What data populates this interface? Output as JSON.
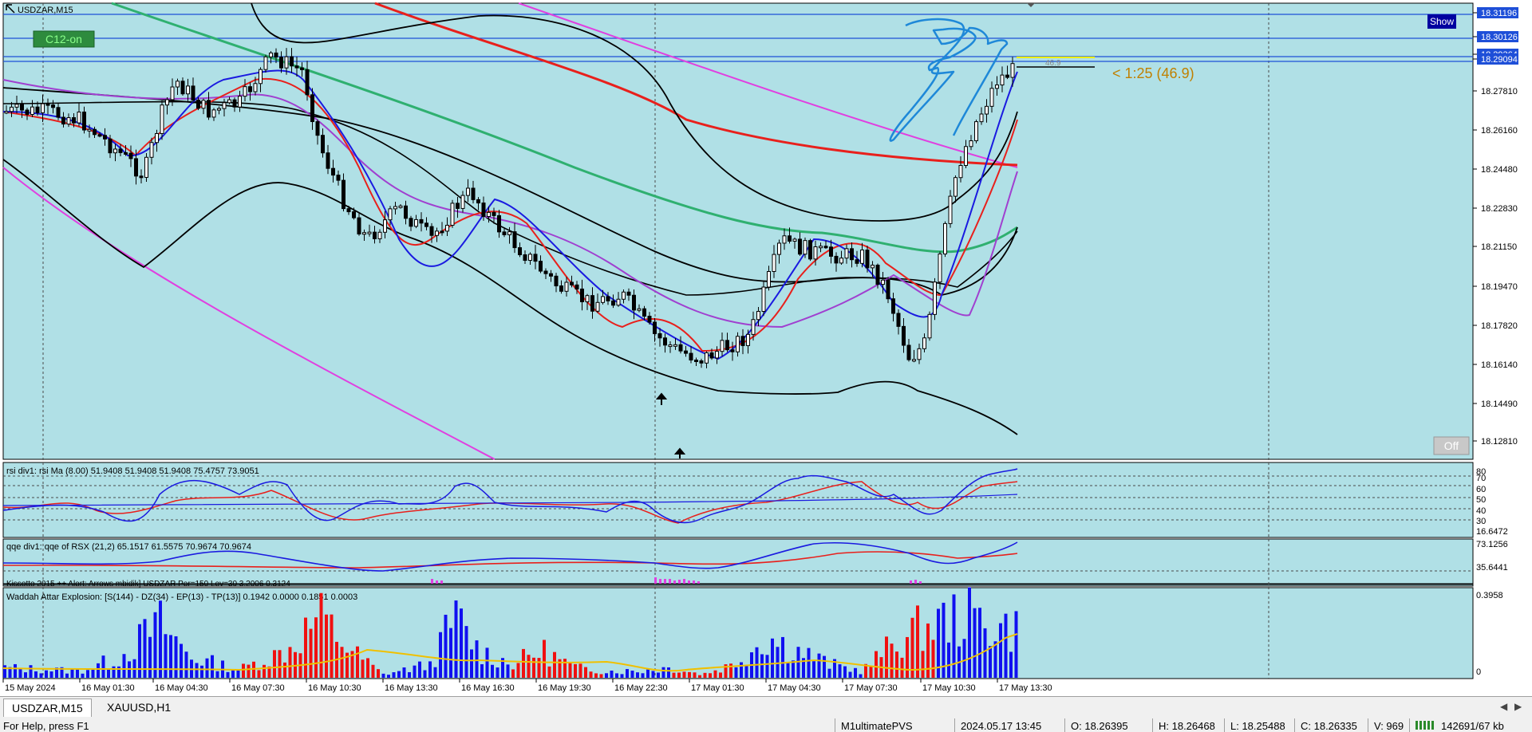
{
  "window": {
    "symbol_label": "USDZAR,M15"
  },
  "buttons": {
    "show": "Show",
    "off": "Off",
    "c12": "C12-on"
  },
  "annotation": {
    "rr_text": "< 1:25 (46.9)",
    "small_value": "46.9"
  },
  "price_axis": {
    "labels": [
      "18.31196",
      "18.30126",
      "18.29364",
      "18.29094",
      "18.27810",
      "18.26160",
      "18.24480",
      "18.22830",
      "18.21150",
      "18.19470",
      "18.17820",
      "18.16140",
      "18.14490",
      "18.12810"
    ],
    "highlighted": [
      "18.31196",
      "18.30126",
      "18.29364",
      "18.29094"
    ]
  },
  "time_axis": {
    "labels": [
      "15 May 2024",
      "16 May 01:30",
      "16 May 04:30",
      "16 May 07:30",
      "16 May 10:30",
      "16 May 13:30",
      "16 May 16:30",
      "16 May 19:30",
      "16 May 22:30",
      "17 May 01:30",
      "17 May 04:30",
      "17 May 07:30",
      "17 May 10:30",
      "17 May 13:30"
    ]
  },
  "indicators": {
    "rsi": {
      "label": "rsi div1: rsi Ma (8.00) 51.9408 51.9408 51.9408 75.4757 73.9051",
      "levels": [
        "80",
        "70",
        "60",
        "50",
        "40",
        "30",
        "16.6472"
      ]
    },
    "qqe": {
      "label": "qqe div1: qqe of RSX (21,2) 65.1517 61.5575 70.9674 70.9674",
      "levels": [
        "73.1256",
        "35.6441"
      ]
    },
    "kiss": {
      "label": "Kissotto 2015 ++ Alert: Arrows mbidik] USDZAR Per=150 Lev=30 3.2006 0.3124"
    },
    "wae": {
      "label": "Waddah Attar Explosion: [S(144) - DZ(34) - EP(13) - TP(13)] 0.1942 0.0000 0.1851 0.0003",
      "levels": [
        "0.3958",
        "0"
      ]
    }
  },
  "tabs": [
    {
      "label": "USDZAR,M15",
      "active": true
    },
    {
      "label": "XAUUSD,H1",
      "active": false
    }
  ],
  "status": {
    "help": "For Help, press F1",
    "profile": "M1ultimatePVS",
    "datetime": "2024.05.17 13:45",
    "open": "O: 18.26395",
    "high": "H: 18.26468",
    "low": "L: 18.25488",
    "close": "C: 18.26335",
    "volume": "V: 969",
    "traffic": "142691/67 kb"
  },
  "colors": {
    "chart_bg": "#b0e0e6",
    "grid": "#4a4a4a",
    "bull": "#ffffff",
    "bear": "#000000",
    "ma_red": "#e8201c",
    "ma_green": "#2fb070",
    "ma_magenta": "#e040e0",
    "ma_blue": "#1a1ae0",
    "ma_purple": "#a040d0",
    "hline": "#1e4fd8",
    "drawing": "#1e88d8",
    "annotation": "#c08000",
    "axis_highlight": "#1e4fd8",
    "wae_blue": "#1010f0",
    "wae_red": "#f01010",
    "wae_yellow": "#f0c000"
  }
}
